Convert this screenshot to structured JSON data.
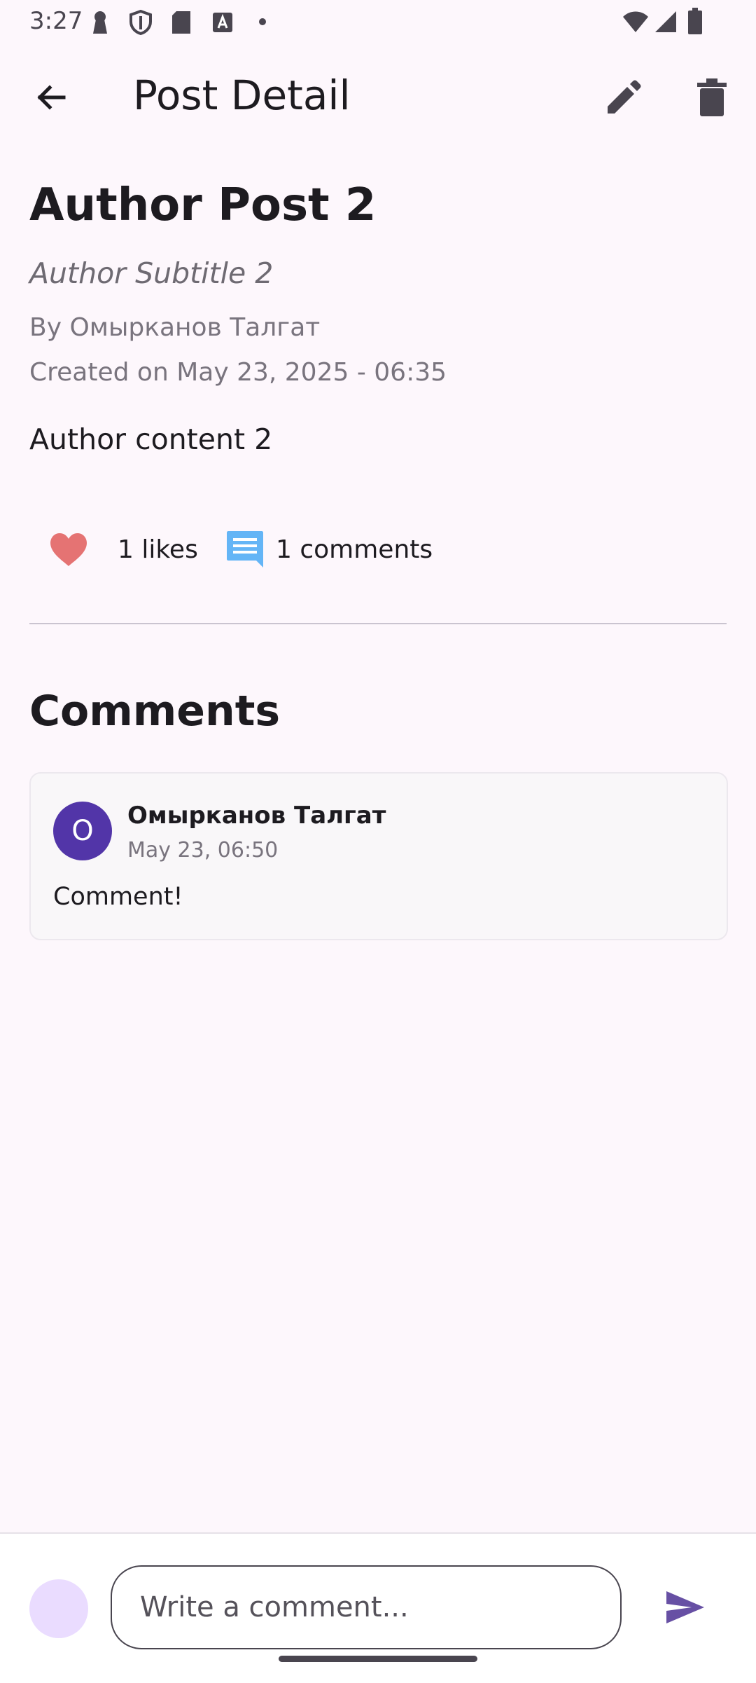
{
  "status_bar": {
    "time": "3:27"
  },
  "app_bar": {
    "title": "Post Detail",
    "back_icon": "arrow-back-icon",
    "edit_icon": "pencil-icon",
    "delete_icon": "trash-icon"
  },
  "post": {
    "title": "Author Post 2",
    "subtitle": "Author Subtitle 2",
    "author_line": "By Омырканов Талгат",
    "created_line": "Created on May 23, 2025 - 06:35",
    "content": "Author content 2",
    "likes_label": "1 likes",
    "comments_label": "1 comments"
  },
  "comments_section": {
    "heading": "Comments",
    "items": [
      {
        "avatar_initial": "О",
        "author": "Омырканов Талгат",
        "time": "May 23, 06:50",
        "text": "Comment!"
      }
    ]
  },
  "composer": {
    "placeholder": "Write a comment...",
    "value": ""
  },
  "colors": {
    "background": "#fdf7fc",
    "accent": "#6750a4",
    "like": "#e57373",
    "comment_icon": "#64b5f6",
    "avatar": "#5235a8",
    "user_avatar": "#eadcff"
  }
}
